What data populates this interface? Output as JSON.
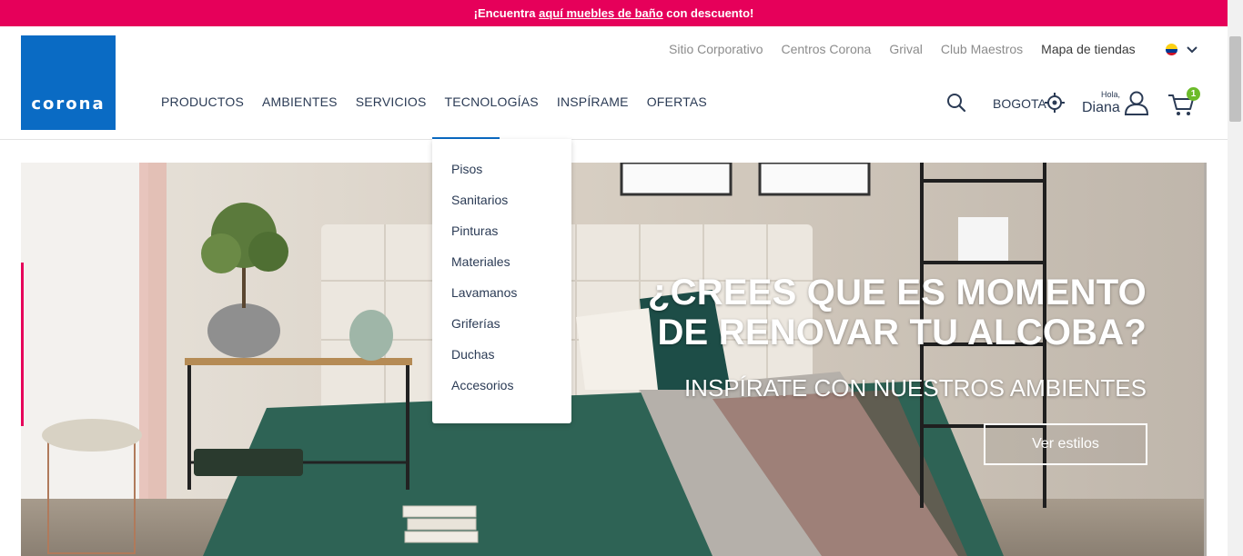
{
  "promo": {
    "prefix": "¡Encuentra ",
    "link": "aquí muebles de baño",
    "suffix": " con descuento!"
  },
  "logo": {
    "text": "corona"
  },
  "top_links": [
    "Sitio Corporativo",
    "Centros Corona",
    "Grival",
    "Club Maestros",
    "Mapa de tiendas"
  ],
  "main_nav": [
    "PRODUCTOS",
    "AMBIENTES",
    "SERVICIOS",
    "TECNOLOGÍAS",
    "INSPÍRAME",
    "OFERTAS"
  ],
  "location": {
    "city": "BOGOTA"
  },
  "user": {
    "greeting": "Hola,",
    "name": "Diana"
  },
  "cart": {
    "count": "1"
  },
  "dropdown": {
    "items": [
      "Pisos",
      "Sanitarios",
      "Pinturas",
      "Materiales",
      "Lavamanos",
      "Griferías",
      "Duchas",
      "Accesorios"
    ]
  },
  "hero": {
    "title_line1": "¿CREES QUE ES MOMENTO",
    "title_line2": "DE RENOVAR TU ALCOBA?",
    "subtitle": "INSPÍRATE CON NUESTROS AMBIENTES",
    "cta": "Ver estilos"
  },
  "colors": {
    "promo": "#e6005a",
    "brand_blue": "#0a6bc4",
    "cart_badge": "#6cbb2a"
  },
  "icons": [
    "search-icon",
    "location-target-icon",
    "user-icon",
    "cart-icon",
    "chevron-down-icon",
    "colombia-flag-icon"
  ]
}
